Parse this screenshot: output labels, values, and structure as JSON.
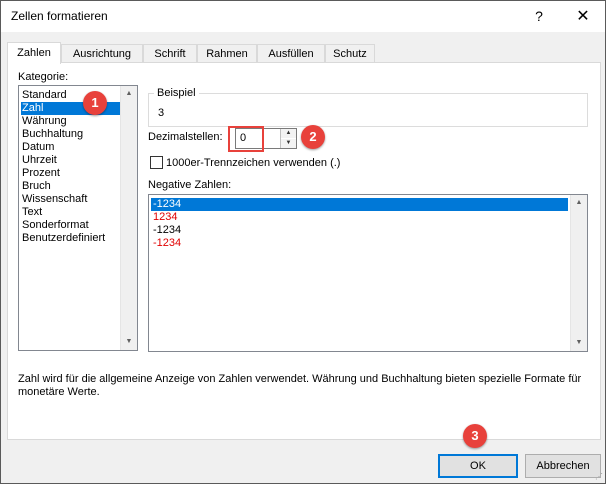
{
  "window": {
    "title": "Zellen formatieren",
    "help_label": "?",
    "close_label": "✕"
  },
  "tabs": [
    "Zahlen",
    "Ausrichtung",
    "Schrift",
    "Rahmen",
    "Ausfüllen",
    "Schutz"
  ],
  "category": {
    "label": "Kategorie:",
    "items": [
      "Standard",
      "Zahl",
      "Währung",
      "Buchhaltung",
      "Datum",
      "Uhrzeit",
      "Prozent",
      "Bruch",
      "Wissenschaft",
      "Text",
      "Sonderformat",
      "Benutzerdefiniert"
    ],
    "selected": "Zahl"
  },
  "sample": {
    "label": "Beispiel",
    "value": "3"
  },
  "decimals": {
    "label": "Dezimalstellen:",
    "value": "0"
  },
  "thousands": {
    "label": "1000er-Trennzeichen verwenden (.)",
    "checked": false
  },
  "negative": {
    "label": "Negative Zahlen:",
    "items": [
      {
        "text": "-1234",
        "color": "#ffffff",
        "selected": true
      },
      {
        "text": "1234",
        "color": "#e00000",
        "selected": false
      },
      {
        "text": "-1234",
        "color": "#000000",
        "selected": false
      },
      {
        "text": "-1234",
        "color": "#e00000",
        "selected": false
      }
    ]
  },
  "description": "Zahl wird für die allgemeine Anzeige von Zahlen verwendet. Währung und Buchhaltung bieten spezielle Formate für monetäre Werte.",
  "buttons": {
    "ok": "OK",
    "cancel": "Abbrechen"
  },
  "badges": [
    "1",
    "2",
    "3"
  ],
  "colors": {
    "selection": "#0078d7",
    "badge": "#e8413b",
    "negative_red": "#e00000"
  }
}
